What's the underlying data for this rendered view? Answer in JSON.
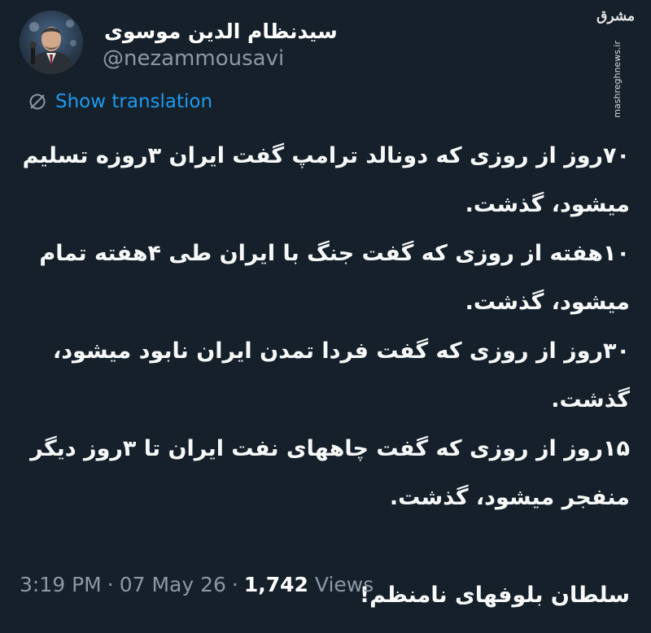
{
  "author": {
    "display_name": "سیدنظام الدین موسوی",
    "handle": "@nezammousavi",
    "avatar_icon": "portrait-avatar"
  },
  "watermark": {
    "logo_text": "مشرق",
    "site": "mashreghnews.ir"
  },
  "translation": {
    "label": "Show translation",
    "icon": "globe-translate-icon"
  },
  "tweet": {
    "paragraphs": [
      "۷۰روز از روزی که دونالد ترامپ گفت ایران ۳روزه تسلیم میشود، گذشت.",
      "۱۰هفته از روزی که گفت جنگ با ایران طی ۴هفته تمام میشود، گذشت.",
      "۳۰روز از روزی که گفت فردا تمدن ایران نابود میشود، گذشت.",
      "۱۵روز از روزی که گفت چاههای نفت ایران تا ۳روز دیگر منفجر میشود، گذشت."
    ],
    "signoff": "سلطان بلوفهای نامنظم!"
  },
  "meta": {
    "time": "3:19 PM",
    "date": "07 May 26",
    "separator": "·",
    "views_count": "1,742",
    "views_label": "Views"
  },
  "colors": {
    "background": "#15202b",
    "text": "#f7f9f9",
    "secondary": "#8b98a5",
    "link": "#1d9bf0"
  }
}
